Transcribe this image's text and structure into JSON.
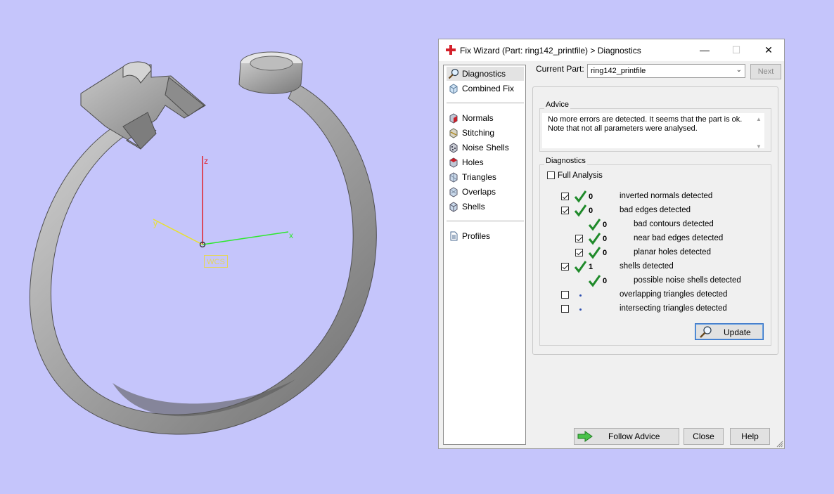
{
  "viewport": {
    "wcs_label": "WCS",
    "axes": {
      "x": "x",
      "y": "y",
      "z": "z"
    },
    "colors": {
      "background": "#c5c5fb",
      "x_axis": "#2ee82e",
      "y_axis": "#e8e030",
      "z_axis": "#e0202a",
      "ring": "#9c9c9c"
    }
  },
  "dialog": {
    "title": "Fix Wizard (Part: ring142_printfile) > Diagnostics",
    "controls": {
      "minimize": "—",
      "maximize": "☐",
      "close": "✕"
    },
    "nav": {
      "items": [
        {
          "label": "Diagnostics",
          "icon": "magnifier-icon",
          "selected": true
        },
        {
          "label": "Combined Fix",
          "icon": "cube-icon"
        },
        {
          "label": "Normals",
          "icon": "normals-cube-icon"
        },
        {
          "label": "Stitching",
          "icon": "stitching-icon"
        },
        {
          "label": "Noise Shells",
          "icon": "noise-shells-icon"
        },
        {
          "label": "Holes",
          "icon": "holes-icon"
        },
        {
          "label": "Triangles",
          "icon": "triangles-icon"
        },
        {
          "label": "Overlaps",
          "icon": "overlaps-icon"
        },
        {
          "label": "Shells",
          "icon": "shells-icon"
        },
        {
          "label": "Profiles",
          "icon": "document-icon"
        }
      ]
    },
    "current_part": {
      "label": "Current Part:",
      "value": "ring142_printfile"
    },
    "next_label": "Next",
    "advice": {
      "title": "Advice",
      "text": "No more errors are detected. It seems that the part is ok. Note that not all parameters were analysed."
    },
    "diagnostics": {
      "title": "Diagnostics",
      "full_analysis_label": "Full Analysis",
      "rows": [
        {
          "checked": true,
          "status": "ok",
          "count": "0",
          "text": "inverted normals detected"
        },
        {
          "checked": true,
          "status": "ok",
          "count": "0",
          "text": "bad edges detected"
        },
        {
          "checked": null,
          "status": "ok",
          "count": "0",
          "text": "bad contours detected"
        },
        {
          "checked": true,
          "status": "ok",
          "count": "0",
          "text": "near bad edges detected"
        },
        {
          "checked": true,
          "status": "ok",
          "count": "0",
          "text": "planar holes detected"
        },
        {
          "checked": true,
          "status": "ok",
          "count": "1",
          "text": "shells detected"
        },
        {
          "checked": null,
          "status": "ok",
          "count": "0",
          "text": "possible noise shells detected"
        },
        {
          "checked": false,
          "status": "none",
          "count": "",
          "text": "overlapping triangles detected"
        },
        {
          "checked": false,
          "status": "none",
          "count": "",
          "text": "intersecting triangles detected"
        }
      ],
      "update_label": "Update"
    },
    "buttons": {
      "follow_advice": "Follow Advice",
      "close": "Close",
      "help": "Help"
    }
  }
}
